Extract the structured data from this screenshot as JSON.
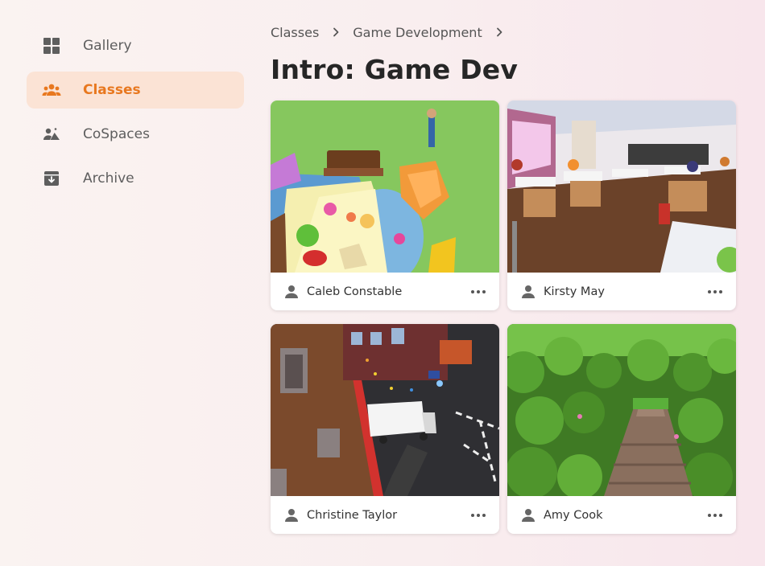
{
  "sidebar": {
    "items": [
      {
        "label": "Gallery",
        "icon": "grid-icon",
        "active": false
      },
      {
        "label": "Classes",
        "icon": "people-icon",
        "active": true
      },
      {
        "label": "CoSpaces",
        "icon": "cospaces-icon",
        "active": false
      },
      {
        "label": "Archive",
        "icon": "archive-icon",
        "active": false
      }
    ]
  },
  "breadcrumb": [
    "Classes",
    "Game Development"
  ],
  "page_title": "Intro: Game Dev",
  "cards": [
    {
      "owner": "Caleb Constable"
    },
    {
      "owner": "Kirsty May"
    },
    {
      "owner": "Christine Taylor"
    },
    {
      "owner": "Amy Cook"
    }
  ],
  "colors": {
    "accent": "#e8781f",
    "active_bg": "#fbe3d5"
  }
}
